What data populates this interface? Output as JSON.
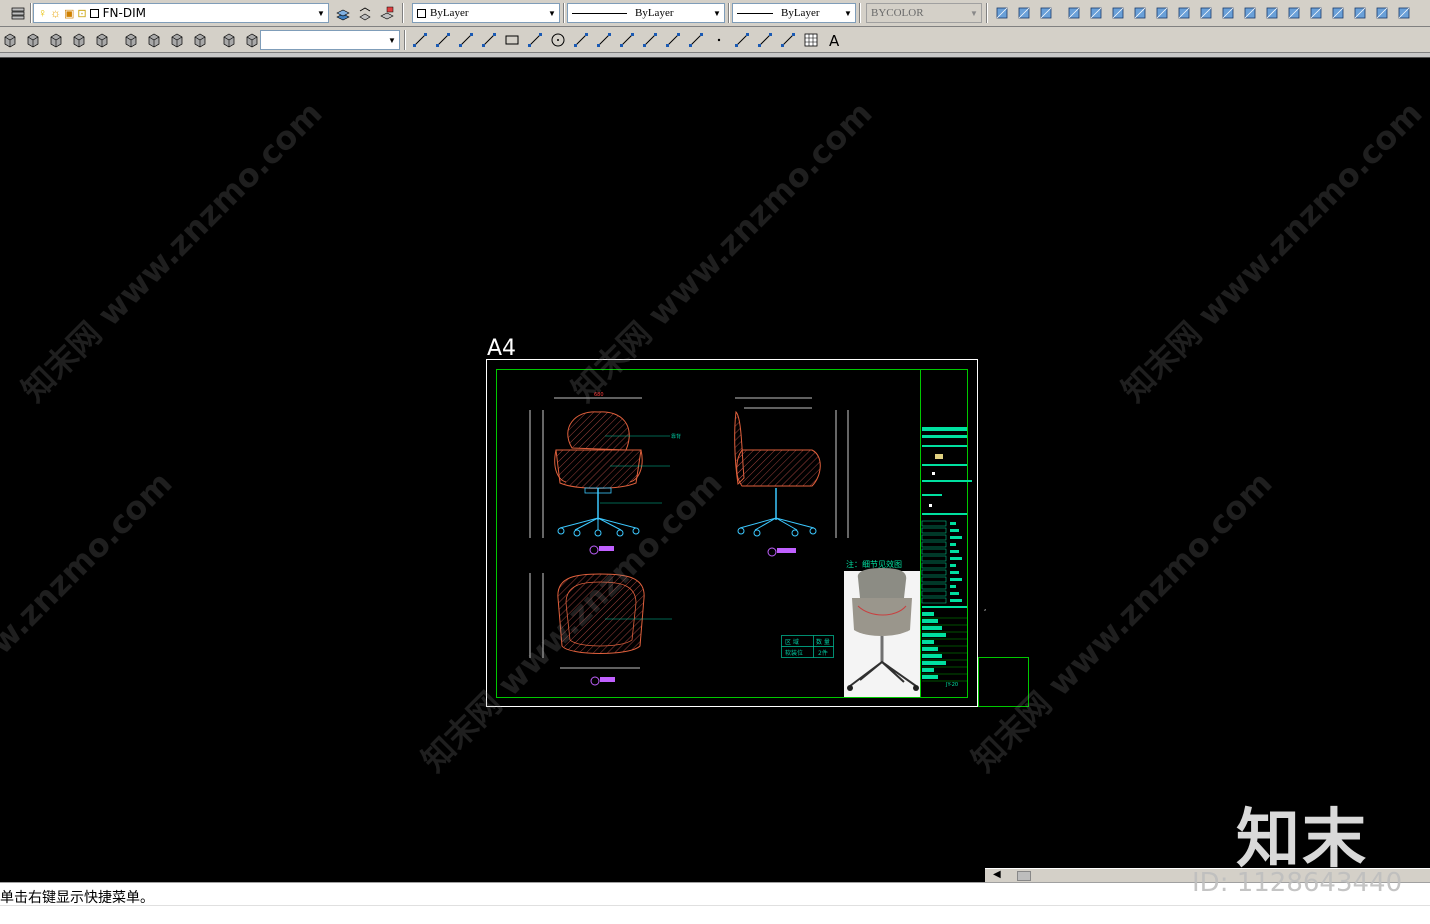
{
  "toolbar1": {
    "layer_combo": "FN-DIM",
    "color_combo": "ByLayer",
    "linetype_combo": "ByLayer",
    "lineweight_combo": "ByLayer",
    "plotstyle_combo": "BYCOLOR"
  },
  "drawing": {
    "sheet_label": "A4",
    "note_label": "注：细节见效图",
    "table": {
      "headers": [
        "区 域",
        "数 量"
      ],
      "row": [
        "软装位",
        "2件"
      ]
    },
    "sheet_number": "JY-20",
    "colors": {
      "frame": "#ffffff",
      "inner_frame": "#00c800",
      "dimension": "#ff3c3c",
      "leader": "#00c8a0",
      "chair_outline": "#e0603c",
      "base": "#3cc8ff",
      "title_block": "#00e0a0",
      "tag": "#c060ff"
    }
  },
  "watermarks": {
    "text": "知末网 www.znzmo.com",
    "brand": "知末"
  },
  "id_mark": "ID: 1128643440",
  "command_line": {
    "text": "单击右键显示快捷菜单。"
  }
}
